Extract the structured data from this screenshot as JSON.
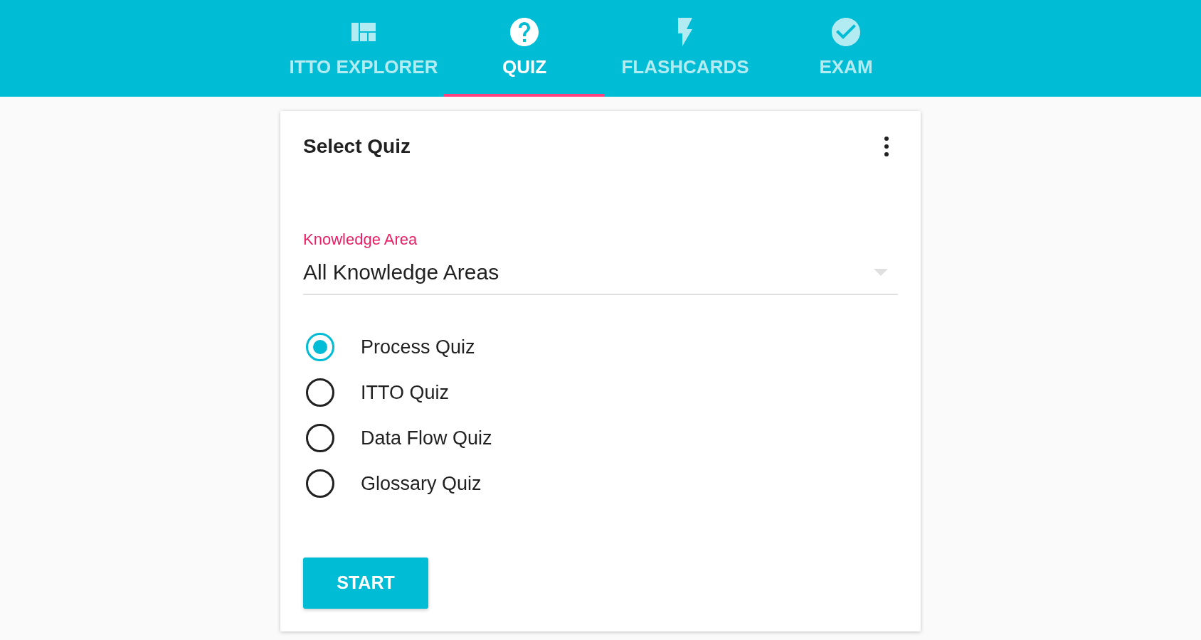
{
  "tabs": [
    {
      "label": "ITTO EXPLORER",
      "selected": false
    },
    {
      "label": "QUIZ",
      "selected": true
    },
    {
      "label": "FLASHCARDS",
      "selected": false
    },
    {
      "label": "EXAM",
      "selected": false
    }
  ],
  "card": {
    "title": "Select Quiz",
    "knowledge_area": {
      "label": "Knowledge Area",
      "value": "All Knowledge Areas"
    },
    "quiz_types": [
      {
        "label": "Process Quiz",
        "selected": true
      },
      {
        "label": "ITTO Quiz",
        "selected": false
      },
      {
        "label": "Data Flow Quiz",
        "selected": false
      },
      {
        "label": "Glossary Quiz",
        "selected": false
      }
    ],
    "start_button": "START"
  }
}
